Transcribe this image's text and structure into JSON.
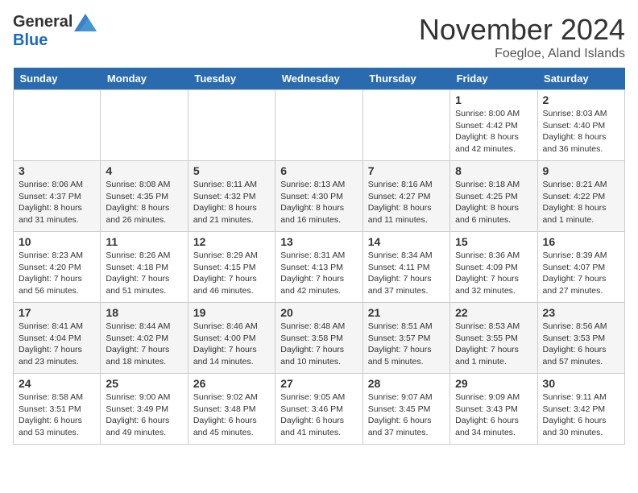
{
  "logo": {
    "general": "General",
    "blue": "Blue"
  },
  "title": "November 2024",
  "location": "Foegloe, Aland Islands",
  "days_of_week": [
    "Sunday",
    "Monday",
    "Tuesday",
    "Wednesday",
    "Thursday",
    "Friday",
    "Saturday"
  ],
  "weeks": [
    [
      {
        "day": "",
        "info": ""
      },
      {
        "day": "",
        "info": ""
      },
      {
        "day": "",
        "info": ""
      },
      {
        "day": "",
        "info": ""
      },
      {
        "day": "",
        "info": ""
      },
      {
        "day": "1",
        "info": "Sunrise: 8:00 AM\nSunset: 4:42 PM\nDaylight: 8 hours and 42 minutes."
      },
      {
        "day": "2",
        "info": "Sunrise: 8:03 AM\nSunset: 4:40 PM\nDaylight: 8 hours and 36 minutes."
      }
    ],
    [
      {
        "day": "3",
        "info": "Sunrise: 8:06 AM\nSunset: 4:37 PM\nDaylight: 8 hours and 31 minutes."
      },
      {
        "day": "4",
        "info": "Sunrise: 8:08 AM\nSunset: 4:35 PM\nDaylight: 8 hours and 26 minutes."
      },
      {
        "day": "5",
        "info": "Sunrise: 8:11 AM\nSunset: 4:32 PM\nDaylight: 8 hours and 21 minutes."
      },
      {
        "day": "6",
        "info": "Sunrise: 8:13 AM\nSunset: 4:30 PM\nDaylight: 8 hours and 16 minutes."
      },
      {
        "day": "7",
        "info": "Sunrise: 8:16 AM\nSunset: 4:27 PM\nDaylight: 8 hours and 11 minutes."
      },
      {
        "day": "8",
        "info": "Sunrise: 8:18 AM\nSunset: 4:25 PM\nDaylight: 8 hours and 6 minutes."
      },
      {
        "day": "9",
        "info": "Sunrise: 8:21 AM\nSunset: 4:22 PM\nDaylight: 8 hours and 1 minute."
      }
    ],
    [
      {
        "day": "10",
        "info": "Sunrise: 8:23 AM\nSunset: 4:20 PM\nDaylight: 7 hours and 56 minutes."
      },
      {
        "day": "11",
        "info": "Sunrise: 8:26 AM\nSunset: 4:18 PM\nDaylight: 7 hours and 51 minutes."
      },
      {
        "day": "12",
        "info": "Sunrise: 8:29 AM\nSunset: 4:15 PM\nDaylight: 7 hours and 46 minutes."
      },
      {
        "day": "13",
        "info": "Sunrise: 8:31 AM\nSunset: 4:13 PM\nDaylight: 7 hours and 42 minutes."
      },
      {
        "day": "14",
        "info": "Sunrise: 8:34 AM\nSunset: 4:11 PM\nDaylight: 7 hours and 37 minutes."
      },
      {
        "day": "15",
        "info": "Sunrise: 8:36 AM\nSunset: 4:09 PM\nDaylight: 7 hours and 32 minutes."
      },
      {
        "day": "16",
        "info": "Sunrise: 8:39 AM\nSunset: 4:07 PM\nDaylight: 7 hours and 27 minutes."
      }
    ],
    [
      {
        "day": "17",
        "info": "Sunrise: 8:41 AM\nSunset: 4:04 PM\nDaylight: 7 hours and 23 minutes."
      },
      {
        "day": "18",
        "info": "Sunrise: 8:44 AM\nSunset: 4:02 PM\nDaylight: 7 hours and 18 minutes."
      },
      {
        "day": "19",
        "info": "Sunrise: 8:46 AM\nSunset: 4:00 PM\nDaylight: 7 hours and 14 minutes."
      },
      {
        "day": "20",
        "info": "Sunrise: 8:48 AM\nSunset: 3:58 PM\nDaylight: 7 hours and 10 minutes."
      },
      {
        "day": "21",
        "info": "Sunrise: 8:51 AM\nSunset: 3:57 PM\nDaylight: 7 hours and 5 minutes."
      },
      {
        "day": "22",
        "info": "Sunrise: 8:53 AM\nSunset: 3:55 PM\nDaylight: 7 hours and 1 minute."
      },
      {
        "day": "23",
        "info": "Sunrise: 8:56 AM\nSunset: 3:53 PM\nDaylight: 6 hours and 57 minutes."
      }
    ],
    [
      {
        "day": "24",
        "info": "Sunrise: 8:58 AM\nSunset: 3:51 PM\nDaylight: 6 hours and 53 minutes."
      },
      {
        "day": "25",
        "info": "Sunrise: 9:00 AM\nSunset: 3:49 PM\nDaylight: 6 hours and 49 minutes."
      },
      {
        "day": "26",
        "info": "Sunrise: 9:02 AM\nSunset: 3:48 PM\nDaylight: 6 hours and 45 minutes."
      },
      {
        "day": "27",
        "info": "Sunrise: 9:05 AM\nSunset: 3:46 PM\nDaylight: 6 hours and 41 minutes."
      },
      {
        "day": "28",
        "info": "Sunrise: 9:07 AM\nSunset: 3:45 PM\nDaylight: 6 hours and 37 minutes."
      },
      {
        "day": "29",
        "info": "Sunrise: 9:09 AM\nSunset: 3:43 PM\nDaylight: 6 hours and 34 minutes."
      },
      {
        "day": "30",
        "info": "Sunrise: 9:11 AM\nSunset: 3:42 PM\nDaylight: 6 hours and 30 minutes."
      }
    ]
  ]
}
